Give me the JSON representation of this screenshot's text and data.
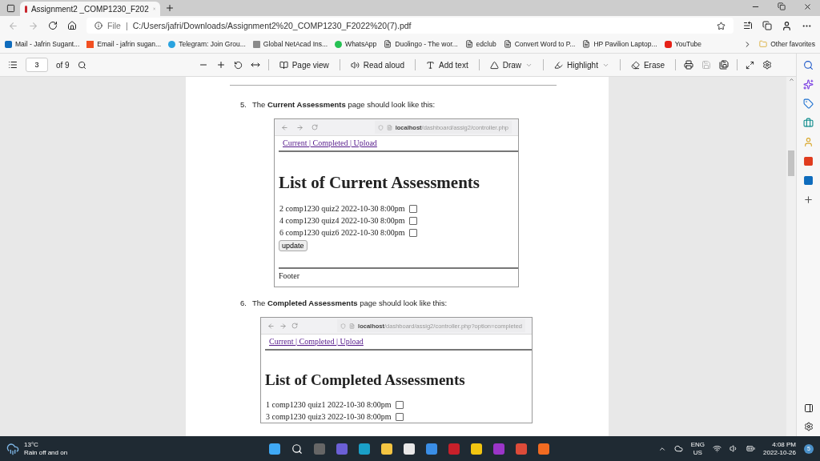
{
  "tabs": [
    {
      "title": "Assignment2 _COMP1230_F202",
      "selected": true
    }
  ],
  "address": {
    "label": "File",
    "separator": "|",
    "url": "C:/Users/jafri/Downloads/Assignment2%20_COMP1230_F2022%20(7).pdf"
  },
  "bookmarks": [
    {
      "label": "Mail - Jafrin Sugant...",
      "kind": "mail"
    },
    {
      "label": "Email - jafrin sugan...",
      "kind": "windows"
    },
    {
      "label": "Telegram: Join Grou...",
      "kind": "telegram"
    },
    {
      "label": "Global NetAcad Ins...",
      "kind": "netacad"
    },
    {
      "label": "WhatsApp",
      "kind": "whatsapp"
    },
    {
      "label": "Duolingo - The wor...",
      "kind": "page"
    },
    {
      "label": "edclub",
      "kind": "page"
    },
    {
      "label": "Convert Word to P...",
      "kind": "page"
    },
    {
      "label": "HP Pavilion Laptop...",
      "kind": "page"
    },
    {
      "label": "YouTube",
      "kind": "youtube"
    }
  ],
  "other_favorites": "Other favorites",
  "pdf_toolbar": {
    "page": "3",
    "of": "of 9",
    "tools": [
      {
        "label": "Page view",
        "kind": "pageview",
        "dropdown": false
      },
      {
        "label": "Read aloud",
        "kind": "read",
        "dropdown": false
      },
      {
        "label": "Add text",
        "kind": "text",
        "dropdown": false
      },
      {
        "label": "Draw",
        "kind": "draw",
        "dropdown": true
      },
      {
        "label": "Highlight",
        "kind": "highlight",
        "dropdown": true
      },
      {
        "label": "Erase",
        "kind": "erase",
        "dropdown": false
      }
    ]
  },
  "document": {
    "items": [
      {
        "number": "5.",
        "text": "The **Current Assessments** page should look like this:",
        "screenshot": {
          "host": "localhost",
          "path": "/dashboard/assig2/controller.php",
          "nav": "Current | Completed | Upload",
          "heading": "List of Current Assessments",
          "rows": [
            {
              "text": "2 comp1230 quiz2 2022-10-30 8:00pm",
              "checked": false
            },
            {
              "text": "4 comp1230 quiz4 2022-10-30 8:00pm",
              "checked": false
            },
            {
              "text": "6 comp1230 quiz6 2022-10-30 8:00pm",
              "checked": false
            }
          ],
          "button": "update",
          "footer": "Footer"
        }
      },
      {
        "number": "6.",
        "text": "The **Completed Assessments** page should look like this:",
        "screenshot": {
          "host": "localhost",
          "path": "/dashboard/assig2/controller.php?option=completed",
          "nav": "Current | Completed | Upload",
          "heading": "List of Completed Assessments",
          "rows": [
            {
              "text": "1 comp1230 quiz1 2022-10-30 8:00pm",
              "checked": false
            },
            {
              "text": "3 comp1230 quiz3 2022-10-30 8:00pm",
              "checked": false
            }
          ]
        }
      }
    ]
  },
  "taskbar": {
    "temperature": "13°C",
    "weather": "Rain off and on",
    "language": "ENG",
    "region": "US",
    "time": "4:08 PM",
    "date": "2022-10-26",
    "notifications": "5"
  }
}
